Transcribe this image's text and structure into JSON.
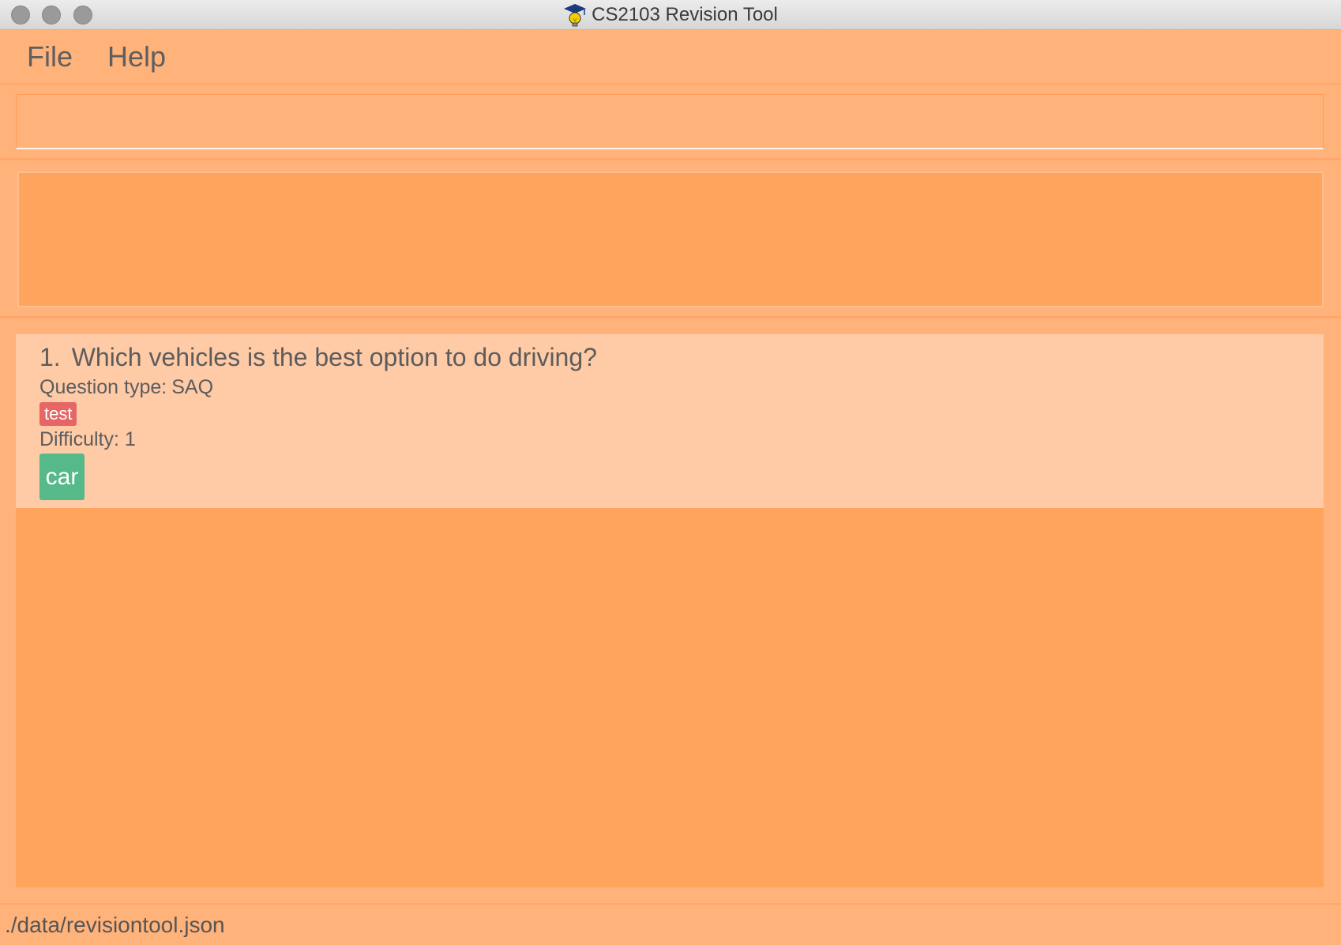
{
  "window": {
    "title": "CS2103 Revision Tool"
  },
  "menu": {
    "items": [
      {
        "label": "File"
      },
      {
        "label": "Help"
      }
    ]
  },
  "command_box": {
    "value": "",
    "placeholder": ""
  },
  "result_display": {
    "text": ""
  },
  "questions": [
    {
      "index": "1.",
      "text": "Which vehicles is the best option to do driving?",
      "type_label": "Question type:",
      "type_value": "SAQ",
      "tag": "test",
      "difficulty_text": "Difficulty: 1",
      "answer": "car"
    }
  ],
  "status_bar": {
    "file_path": "./data/revisiontool.json"
  },
  "colors": {
    "background": "#ffb27a",
    "panel": "#ffa45c",
    "card": "#ffcaa6",
    "tag_red": "#e66565",
    "answer_green": "#56b98a"
  },
  "icons": {
    "app": "graduation-cap-lightbulb-icon"
  }
}
